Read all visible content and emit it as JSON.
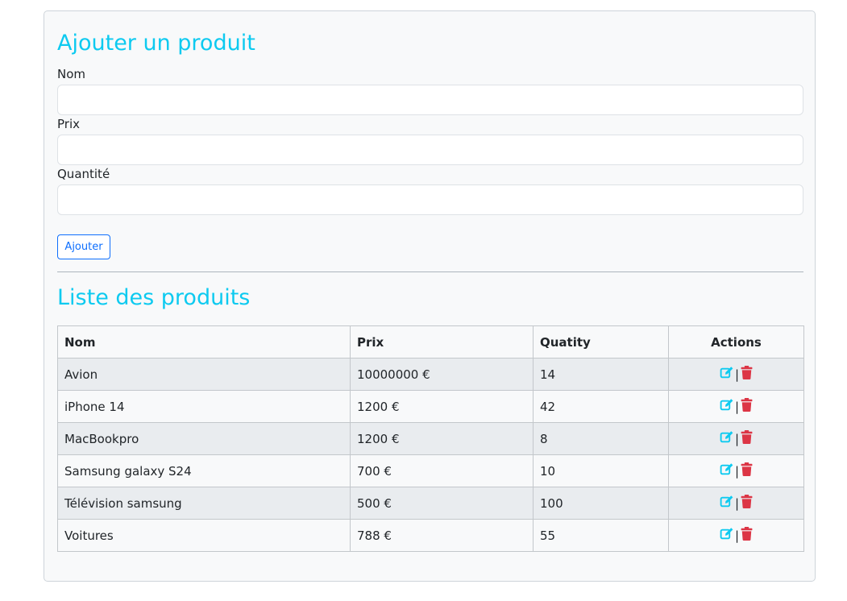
{
  "form": {
    "title": "Ajouter un produit",
    "fields": [
      {
        "label": "Nom",
        "value": "",
        "placeholder": ""
      },
      {
        "label": "Prix",
        "value": "",
        "placeholder": ""
      },
      {
        "label": "Quantité",
        "value": "",
        "placeholder": ""
      }
    ],
    "submit_label": "Ajouter"
  },
  "list": {
    "title": "Liste des produits",
    "columns": [
      "Nom",
      "Prix",
      "Quatity",
      "Actions"
    ],
    "rows": [
      {
        "nom": "Avion",
        "prix": "10000000 €",
        "quantity": "14"
      },
      {
        "nom": "iPhone 14",
        "prix": "1200 €",
        "quantity": "42"
      },
      {
        "nom": "MacBookpro",
        "prix": "1200 €",
        "quantity": "8"
      },
      {
        "nom": "Samsung galaxy S24",
        "prix": "700 €",
        "quantity": "10"
      },
      {
        "nom": "Télévision samsung",
        "prix": "500 €",
        "quantity": "100"
      },
      {
        "nom": "Voitures",
        "prix": "788 €",
        "quantity": "55"
      }
    ],
    "action_separator": "|",
    "icons": {
      "edit": "edit-icon",
      "delete": "trash-icon"
    }
  },
  "colors": {
    "heading": "#0dcaf0",
    "primary": "#0d6efd",
    "edit_icon": "#0dcaf0",
    "delete_icon": "#dc3545",
    "card_bg": "#f8f9fa"
  }
}
